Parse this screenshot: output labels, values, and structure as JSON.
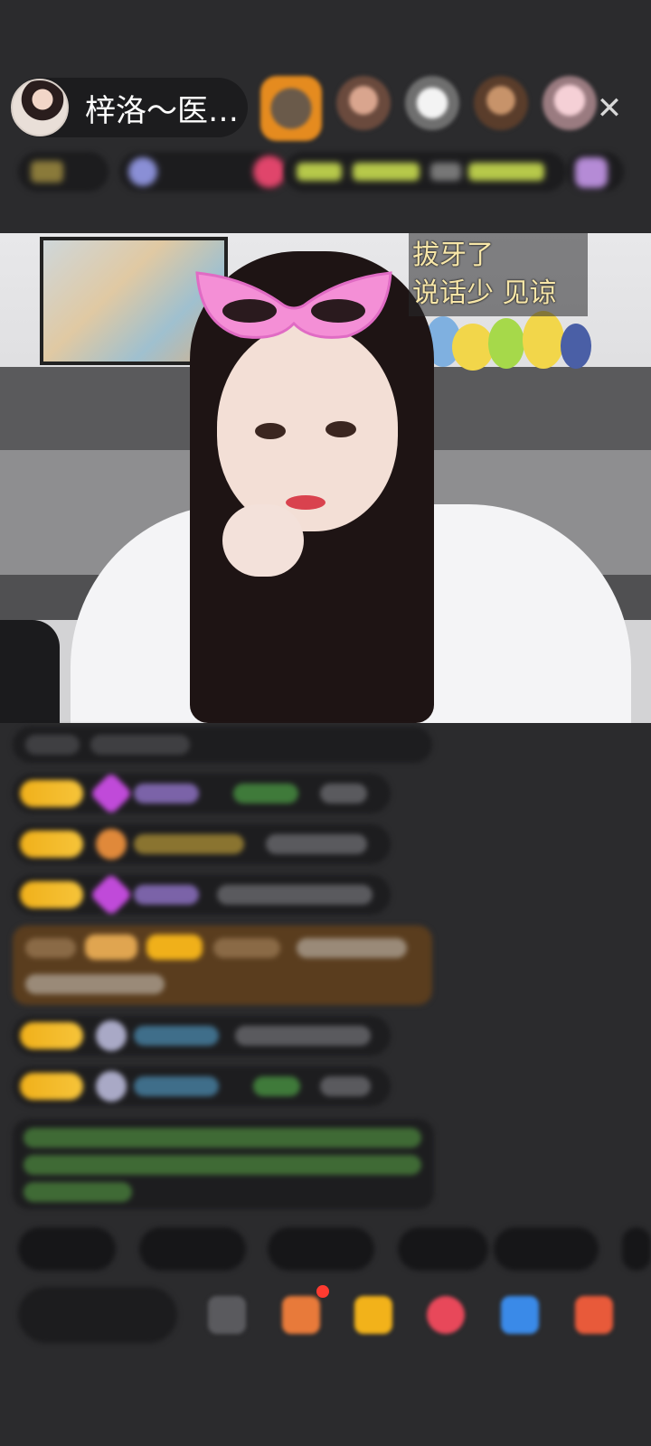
{
  "header": {
    "host_name": "梓洛～医…",
    "close_glyph": "✕"
  },
  "stream": {
    "caption_lines": [
      "拔牙了",
      "说话少 见谅"
    ]
  },
  "colors": {
    "background": "#2b2b2d",
    "caption_text": "#f7e6a8",
    "level_badge": "#f0b01a",
    "vip_message_bg": "#5a3d1e",
    "notice_text": "#7fcf6a"
  },
  "icons": {
    "close": "close-icon",
    "host_avatar": "host-avatar",
    "gift": "gift-icon",
    "more": "more-icon"
  }
}
